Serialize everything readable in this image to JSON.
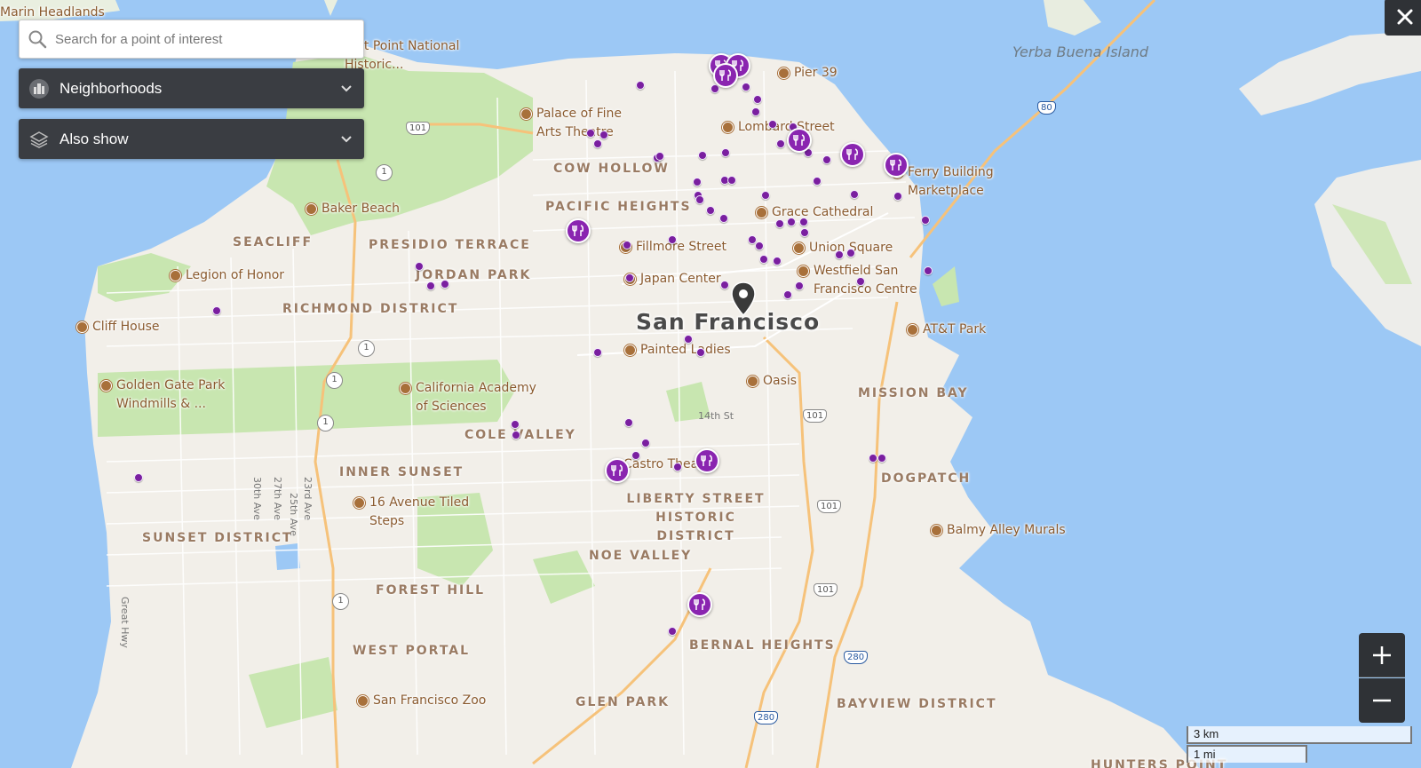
{
  "search": {
    "placeholder": "Search for a point of interest"
  },
  "panels": {
    "neighborhoods": {
      "label": "Neighborhoods",
      "icon": "city-icon"
    },
    "also_show": {
      "label": "Also show",
      "icon": "layers-icon"
    }
  },
  "controls": {
    "close_icon": "close-icon",
    "zoom_in_icon": "plus-icon",
    "zoom_out_icon": "minus-icon"
  },
  "scale": {
    "km": "3 km",
    "mi": "1 mi"
  },
  "map": {
    "city": "San Francisco",
    "islands": [
      "Yerba Buena Island"
    ],
    "top_label": "Marin Headlands",
    "districts": [
      "COW HOLLOW",
      "PACIFIC HEIGHTS",
      "SEACLIFF",
      "PRESIDIO TERRACE",
      "JORDAN PARK",
      "RICHMOND DISTRICT",
      "MISSION BAY",
      "COLE VALLEY",
      "INNER SUNSET",
      "LIBERTY STREET HISTORIC DISTRICT",
      "SUNSET DISTRICT",
      "NOE VALLEY",
      "DOGPATCH",
      "FOREST HILL",
      "WEST PORTAL",
      "BERNAL HEIGHTS",
      "GLEN PARK",
      "BAYVIEW DISTRICT",
      "HUNTERS POINT"
    ],
    "pois": [
      "Fort Point National Historic...",
      "Pier 39",
      "Palace of Fine Arts Theatre",
      "Lombard Street",
      "Ferry Building Marketplace",
      "Baker Beach",
      "Grace Cathedral",
      "Fillmore Street",
      "Union Square",
      "Legion of Honor",
      "Japan Center",
      "Westfield San Francisco Centre",
      "Cliff House",
      "AT&T Park",
      "Painted Ladies",
      "Oasis",
      "Golden Gate Park Windmills & ...",
      "California Academy of Sciences",
      "Castro Theatre",
      "16 Avenue Tiled Steps",
      "Balmy Alley Murals",
      "San Francisco Zoo"
    ],
    "streets": [
      "14th St",
      "Great Hwy",
      "30th Ave",
      "27th Ave",
      "25th Ave",
      "23rd Ave"
    ],
    "highways": [
      "101",
      "1",
      "80",
      "280"
    ],
    "selected_marker": "location-pin-icon",
    "restaurant_icon": "fork-knife-icon",
    "colors": {
      "water": "#9cc8f5",
      "land": "#f2efe9",
      "park": "#c8e6b0",
      "marker": "#7a1fa0",
      "poi": "#a8703a",
      "panel": "#3a3d42"
    }
  }
}
